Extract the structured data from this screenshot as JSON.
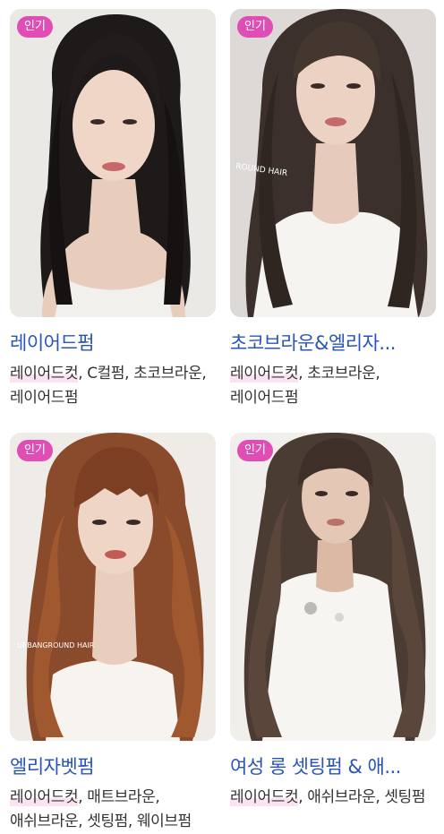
{
  "colors": {
    "title": "#2a55b8",
    "badge_bg": "#e04db5",
    "tag_text": "#333333",
    "tag_highlight": "#fbe3f2"
  },
  "cards": [
    {
      "badge": "인기",
      "title": "레이어드펌",
      "tag_highlight": "레이어드컷",
      "tags_rest": ", C컬펌, 초코브라운, 레이어드펌",
      "image": "woman-straight-black-layered-hair",
      "watermark": ""
    },
    {
      "badge": "인기",
      "title": "초코브라운&엘리자...",
      "tag_highlight": "레이어드컷",
      "tags_rest": ", 초코브라운, 레이어드펌",
      "image": "woman-choco-brown-layered-hair",
      "watermark": "ROUND HAIR"
    },
    {
      "badge": "인기",
      "title": "엘리자벳펌",
      "tag_highlight": "레이어드컷",
      "tags_rest": ", 매트브라운, 애쉬브라운, 셋팅펌, 웨이브펌",
      "image": "woman-brown-wavy-hair-with-bangs",
      "watermark": "URBANGROUND HAIR"
    },
    {
      "badge": "인기",
      "title": "여성 롱 셋팅펌 & 애...",
      "tag_highlight": "레이어드컷",
      "tags_rest": ", 애쉬브라운, 셋팅펌",
      "image": "woman-long-wavy-hair-white-blouse",
      "watermark": ""
    }
  ]
}
